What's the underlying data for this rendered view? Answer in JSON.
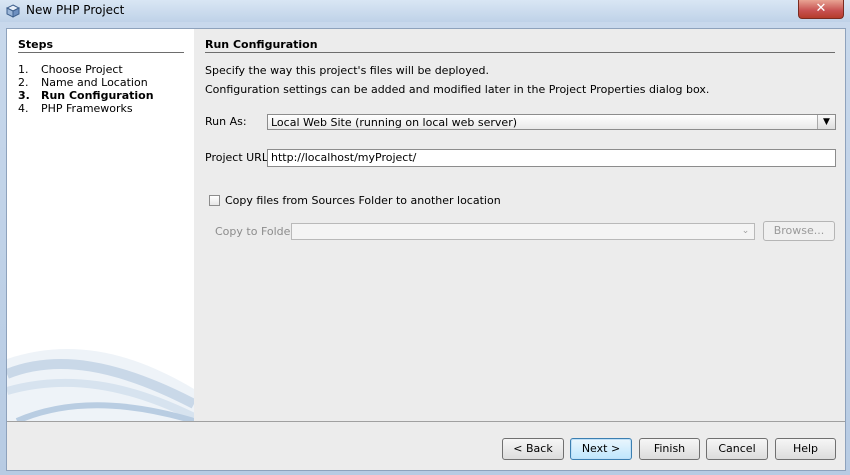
{
  "window": {
    "title": "New PHP Project",
    "close_glyph": "✕"
  },
  "steps": {
    "title": "Steps",
    "items": [
      {
        "num": "1.",
        "label": "Choose Project"
      },
      {
        "num": "2.",
        "label": "Name and Location"
      },
      {
        "num": "3.",
        "label": "Run Configuration"
      },
      {
        "num": "4.",
        "label": "PHP Frameworks"
      }
    ]
  },
  "panel": {
    "title": "Run Configuration",
    "desc1": "Specify the way this project's files will be deployed.",
    "desc2": "Configuration settings can be added and modified later in the Project Properties dialog box.",
    "run_as_label": "Run As:",
    "run_as_value": "Local Web Site (running on local web server)",
    "project_url_label": "Project URL:",
    "project_url_value": "http://localhost/myProject/",
    "copy_files_label": "Copy files from Sources Folder to another location",
    "copy_to_label": "Copy to Folder:",
    "copy_to_value": "",
    "browse_label": "Browse..."
  },
  "buttons": {
    "back": "< Back",
    "next": "Next >",
    "finish": "Finish",
    "cancel": "Cancel",
    "help": "Help"
  },
  "icons": {
    "app": "netbeans-cube-icon",
    "dropdown": "chevron-down-icon"
  }
}
